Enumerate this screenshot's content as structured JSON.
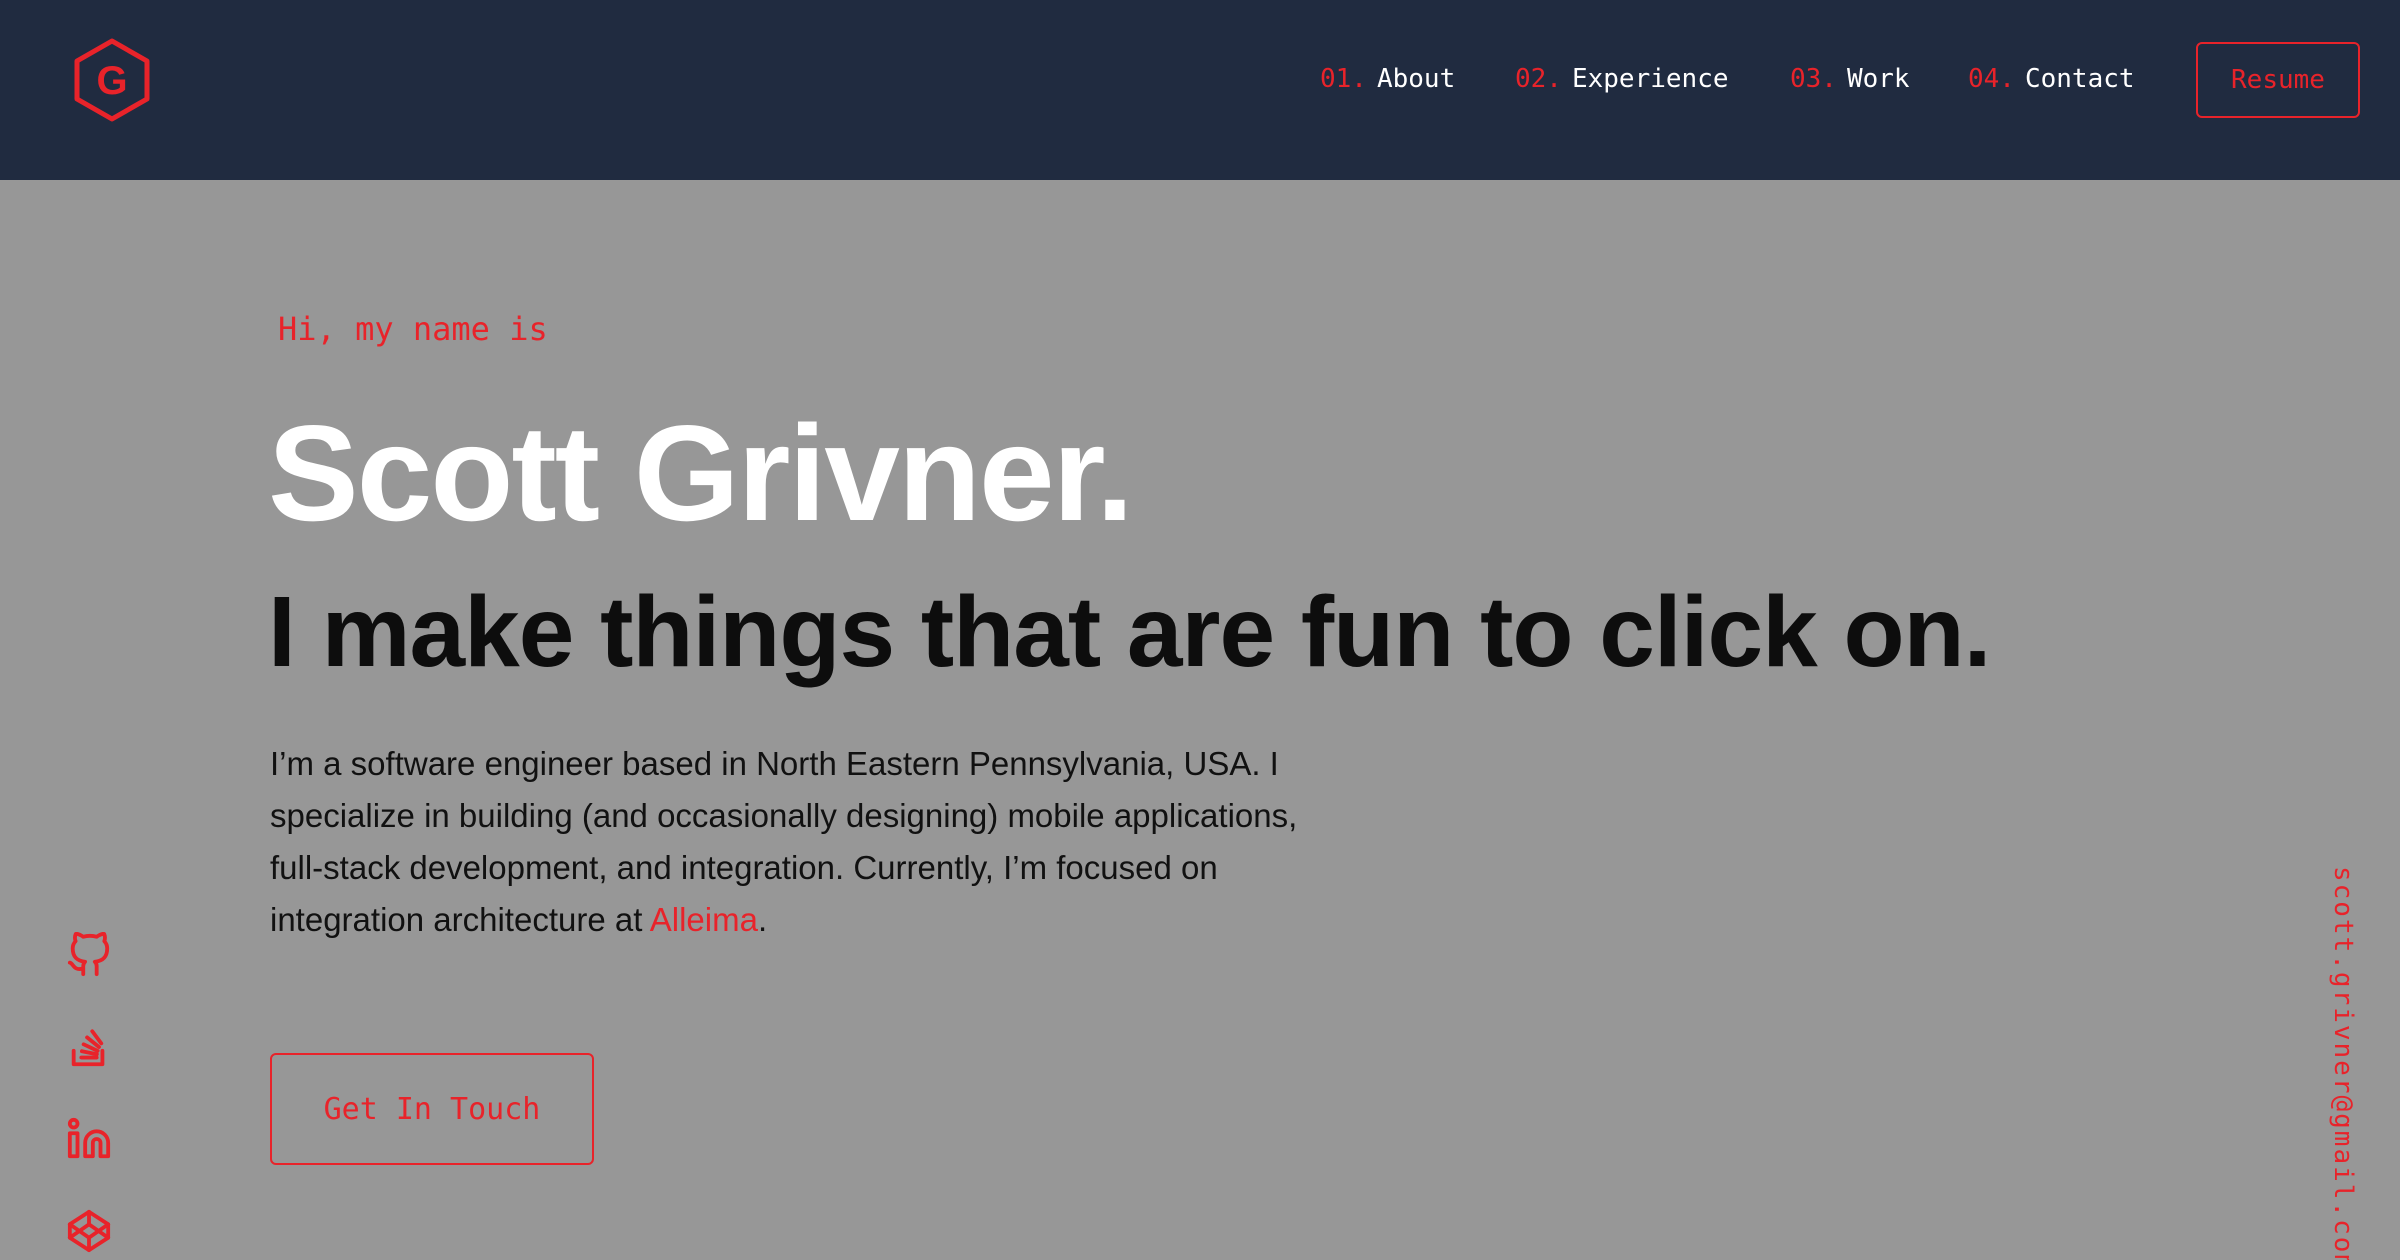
{
  "header": {
    "logo_letter": "G",
    "nav": [
      {
        "num": "01.",
        "label": "About"
      },
      {
        "num": "02.",
        "label": "Experience"
      },
      {
        "num": "03.",
        "label": "Work"
      },
      {
        "num": "04.",
        "label": "Contact"
      }
    ],
    "resume_label": "Resume"
  },
  "hero": {
    "greeting": "Hi, my name is",
    "name": "Scott Grivner.",
    "tagline": "I make things that are fun to click on.",
    "bio_before": "I’m a software engineer based in North Eastern Pennsylvania, USA. I specialize in building (and occasionally designing) mobile applications, full-stack development, and integration. Currently, I’m focused on integration architecture at ",
    "bio_link": "Alleima",
    "bio_after": ".",
    "cta_label": "Get In Touch"
  },
  "social": {
    "icons": [
      "github-icon",
      "stackoverflow-icon",
      "linkedin-icon",
      "codepen-icon"
    ]
  },
  "email": "scott.grivner@gmail.com",
  "colors": {
    "accent": "#e8232a",
    "header_bg": "#202b40",
    "page_bg": "#979797"
  }
}
